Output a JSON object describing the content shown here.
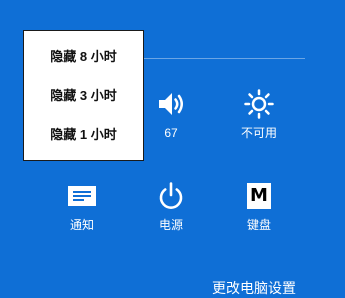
{
  "colors": {
    "background": "#0f6fd6",
    "menu_background": "#ffffff",
    "menu_text": "#111111",
    "tile_text": "#ffffff"
  },
  "hide_menu": {
    "items": [
      {
        "label": "隐藏 8 小时"
      },
      {
        "label": "隐藏 3 小时"
      },
      {
        "label": "隐藏 1 小时"
      }
    ]
  },
  "tiles": {
    "volume": {
      "icon": "speaker-icon",
      "label": "67"
    },
    "brightness": {
      "icon": "sun-icon",
      "label": "不可用"
    },
    "notifications": {
      "icon": "notification-icon",
      "label": "通知"
    },
    "power": {
      "icon": "power-icon",
      "label": "电源"
    },
    "keyboard": {
      "icon": "keyboard-icon",
      "glyph": "M",
      "label": "键盘"
    }
  },
  "footer": {
    "change_settings_label": "更改电脑设置"
  }
}
